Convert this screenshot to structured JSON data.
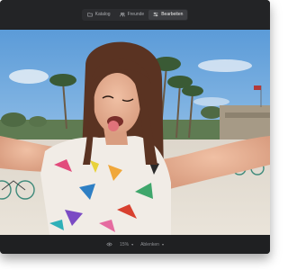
{
  "toolbar": {
    "tabs": [
      {
        "label": "Katalog",
        "icon": "folder-icon",
        "active": false
      },
      {
        "label": "Freunde",
        "icon": "people-icon",
        "active": false
      },
      {
        "label": "Bearbeiten",
        "icon": "sliders-icon",
        "active": true
      }
    ]
  },
  "photo": {
    "description_icon": "photo-selfie"
  },
  "bottom_bar": {
    "zoom_label": "15%",
    "view_label": "Ablenken"
  },
  "colors": {
    "window_bg": "#1f2022",
    "toolbar_bg": "#232426",
    "active_tab_bg": "#3d3e42",
    "sky_top": "#5b9bd8",
    "sky_bottom": "#a8cbe8"
  }
}
